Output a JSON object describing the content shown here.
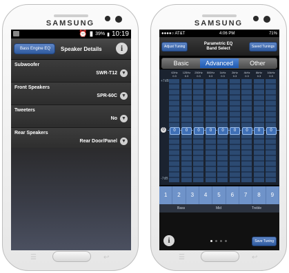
{
  "left_phone": {
    "brand": "SAMSUNG",
    "status_time": "10:19",
    "status_battery": "39%",
    "back_button": "Bass Engine EQ",
    "title": "Speaker Details",
    "info": "i",
    "rows": [
      {
        "label": "Subwoofer",
        "value": "SWR-T12"
      },
      {
        "label": "Front Speakers",
        "value": "SPR-60C"
      },
      {
        "label": "Tweeters",
        "value": "No"
      },
      {
        "label": "Rear Speakers",
        "value": "Rear Door/Panel"
      }
    ]
  },
  "right_phone": {
    "brand": "SAMSUNG",
    "carrier": "●●●●○ AT&T",
    "time": "4:06 PM",
    "battery": "71%",
    "adjust_button": "Adjust Tuning",
    "title_line1": "Parametric EQ",
    "title_line2": "Band Select",
    "saved_button": "Saved Tunings",
    "tabs": [
      "Basic",
      "Advanced",
      "Other"
    ],
    "selected_tab": "Advanced",
    "top_db": "+7dB",
    "bottom_db": "-7dB",
    "freqs": [
      "63Hz",
      "125Hz",
      "250Hz",
      "500Hz",
      "1kHz",
      "2kHz",
      "4kHz",
      "8kHz",
      "16kHz"
    ],
    "q_values": [
      "0.3",
      "0.3",
      "0.3",
      "0.3",
      "0.3",
      "0.3",
      "0.3",
      "0.3",
      "0.3"
    ],
    "gains": [
      "0",
      "0",
      "0",
      "0",
      "0",
      "0",
      "0",
      "0",
      "0"
    ],
    "band_numbers": [
      "1",
      "2",
      "3",
      "4",
      "5",
      "6",
      "7",
      "8",
      "9"
    ],
    "groups": {
      "bass": "Bass",
      "mid": "Mid",
      "treble": "Treble"
    },
    "info": "i",
    "save_button": "Save Tuning"
  }
}
